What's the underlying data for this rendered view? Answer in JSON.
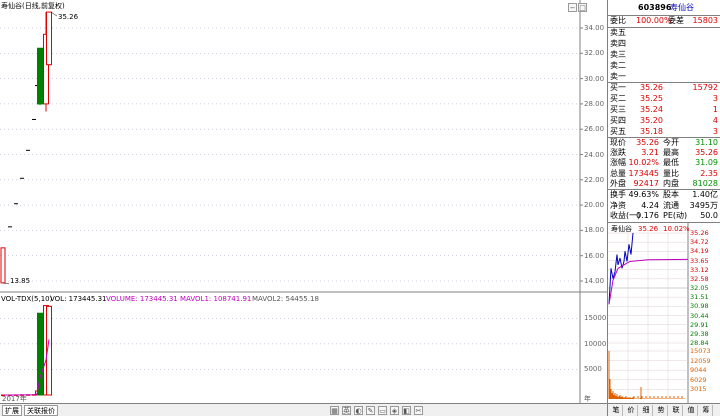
{
  "header": {
    "title": "寿仙谷(日线,前复权)",
    "price_high_label": "35.26",
    "price_low_label": "13.85"
  },
  "price_axis": [
    "34.00",
    "32.00",
    "30.00",
    "28.00",
    "26.00",
    "24.00",
    "22.00",
    "20.00",
    "18.00",
    "16.00",
    "14.00"
  ],
  "volume_header": {
    "indicator": "VOL-TDX(5,10)",
    "vol": "VOL: 173445.31",
    "volume": "VOLUME: 173445.31",
    "mavol1": "MAVOL1: 108741.91",
    "mavol2": "MAVOL2: 54455.18"
  },
  "volume_axis": [
    "15000",
    "10000",
    "5000"
  ],
  "x_axis": {
    "year_label": "2017年",
    "year_unit": "年"
  },
  "bottom_bar": {
    "tab1": "扩展",
    "tab2": "关联报价",
    "icons": [
      "▦",
      "英",
      "◐",
      "✎",
      "▭",
      "◈",
      "◧",
      "✂"
    ]
  },
  "stock": {
    "code": "603896",
    "name": "寿仙谷"
  },
  "order_book": {
    "weibi_label": "委比",
    "weibi_value": "100.00%",
    "weicha_label": "委差",
    "weicha_value": "15803",
    "sell": [
      {
        "label": "卖五",
        "price": "",
        "vol": ""
      },
      {
        "label": "卖四",
        "price": "",
        "vol": ""
      },
      {
        "label": "卖三",
        "price": "",
        "vol": ""
      },
      {
        "label": "卖二",
        "price": "",
        "vol": ""
      },
      {
        "label": "卖一",
        "price": "",
        "vol": ""
      }
    ],
    "buy": [
      {
        "label": "买一",
        "price": "35.26",
        "vol": "15792"
      },
      {
        "label": "买二",
        "price": "35.25",
        "vol": "3"
      },
      {
        "label": "买三",
        "price": "35.24",
        "vol": "1"
      },
      {
        "label": "买四",
        "price": "35.20",
        "vol": "4"
      },
      {
        "label": "买五",
        "price": "35.18",
        "vol": "3"
      }
    ]
  },
  "quote": [
    {
      "l1": "现价",
      "v1": "35.26",
      "c1": "red",
      "l2": "今开",
      "v2": "31.10",
      "c2": "green"
    },
    {
      "l1": "涨跌",
      "v1": "3.21",
      "c1": "red",
      "l2": "最高",
      "v2": "35.26",
      "c2": "red"
    },
    {
      "l1": "涨幅",
      "v1": "10.02%",
      "c1": "red",
      "l2": "最低",
      "v2": "31.09",
      "c2": "green"
    },
    {
      "l1": "总量",
      "v1": "173445",
      "c1": "red",
      "l2": "量比",
      "v2": "2.35",
      "c2": "red"
    },
    {
      "l1": "外盘",
      "v1": "92417",
      "c1": "red",
      "l2": "内盘",
      "v2": "81028",
      "c2": "green"
    }
  ],
  "finance": [
    {
      "l1": "换手",
      "v1": "49.63%",
      "l2": "股本",
      "v2": "1.40亿"
    },
    {
      "l1": "净资",
      "v1": "4.24",
      "l2": "流通",
      "v2": "3495万"
    },
    {
      "l1": "收益(一)",
      "v1": "0.176",
      "l2": "PE(动)",
      "v2": "50.0"
    }
  ],
  "mini_chart": {
    "name": "寿仙谷",
    "price": "35.26",
    "pct": "10.02%",
    "price_axis": [
      "35.26",
      "34.72",
      "34.19",
      "33.65",
      "33.12",
      "32.58",
      "32.05",
      "31.51",
      "30.98",
      "30.44",
      "29.91",
      "29.38",
      "28.84"
    ],
    "price_axis_colors": [
      "red",
      "red",
      "red",
      "red",
      "red",
      "red",
      "green",
      "green",
      "green",
      "green",
      "green",
      "green",
      "green"
    ],
    "vol_axis": [
      "15073",
      "12059",
      "9044",
      "6029",
      "3015"
    ]
  },
  "right_tabs": [
    "笔",
    "价",
    "细",
    "势",
    "联",
    "值",
    "筹"
  ],
  "colors": {
    "up": "#e00000",
    "down": "#008000",
    "mavol": "#c000c0",
    "grid": "#a0a0c0",
    "intraday": "#0000c0",
    "avg": "#c000c0"
  },
  "chart_data": {
    "type": "candlestick",
    "candles": [
      {
        "open": 13.85,
        "close": 16.62,
        "high": 16.62,
        "low": 13.85,
        "vol": 4
      },
      {
        "open": 18.28,
        "close": 18.28,
        "high": 18.28,
        "low": 18.28,
        "vol": 12
      },
      {
        "open": 20.11,
        "close": 20.11,
        "high": 20.11,
        "low": 20.11,
        "vol": 20
      },
      {
        "open": 22.12,
        "close": 22.12,
        "high": 22.12,
        "low": 22.12,
        "vol": 30
      },
      {
        "open": 24.33,
        "close": 24.33,
        "high": 24.33,
        "low": 24.33,
        "vol": 45
      },
      {
        "open": 26.77,
        "close": 26.77,
        "high": 26.77,
        "low": 26.77,
        "vol": 60
      },
      {
        "open": 29.45,
        "close": 29.45,
        "high": 29.45,
        "low": 29.45,
        "vol": 800
      },
      {
        "open": 32.4,
        "close": 28.0,
        "high": 32.4,
        "low": 27.9,
        "vol": 16000
      },
      {
        "open": 28.0,
        "close": 33.5,
        "high": 35.26,
        "low": 27.4,
        "vol": 17500
      },
      {
        "open": 31.1,
        "close": 35.26,
        "high": 35.26,
        "low": 31.09,
        "vol": 17345
      }
    ],
    "mavol": [
      2,
      6,
      11,
      16,
      22,
      33,
      190,
      3380,
      6850,
      10874
    ]
  }
}
